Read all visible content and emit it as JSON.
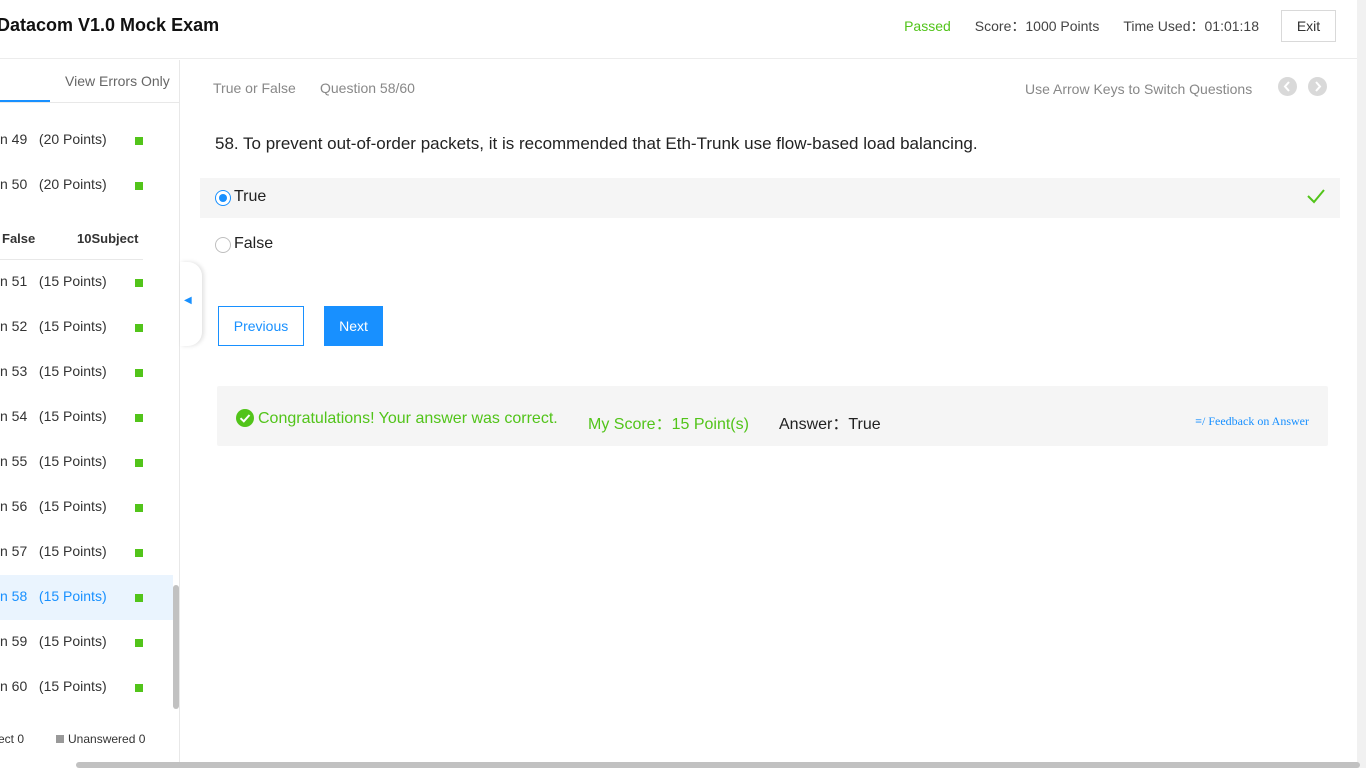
{
  "header": {
    "title": "Datacom V1.0 Mock Exam",
    "status": "Passed",
    "score": "Score：1000 Points",
    "time_used": "Time Used：01:01:18",
    "exit_label": "Exit"
  },
  "sidebar": {
    "tab_errors": "View Errors Only",
    "items_top": [
      {
        "label": "n 49   (20 Points)"
      },
      {
        "label": "n 50   (20 Points)"
      }
    ],
    "section": {
      "name": "False",
      "count": "10Subject"
    },
    "items": [
      {
        "label": "n 51   (15 Points)"
      },
      {
        "label": "n 52   (15 Points)"
      },
      {
        "label": "n 53   (15 Points)"
      },
      {
        "label": "n 54   (15 Points)"
      },
      {
        "label": "n 55   (15 Points)"
      },
      {
        "label": "n 56   (15 Points)"
      },
      {
        "label": "n 57   (15 Points)"
      },
      {
        "label": "n 58   (15 Points)"
      },
      {
        "label": "n 59   (15 Points)"
      },
      {
        "label": "n 60   (15 Points)"
      }
    ],
    "current_index": 7,
    "legend": {
      "incorrect": "ect 0",
      "unanswered": "Unanswered 0"
    },
    "collapse_glyph": "◀"
  },
  "main": {
    "question_type": "True or False",
    "question_number": "Question 58/60",
    "nav_hint": "Use Arrow Keys to Switch Questions",
    "question_text": "58. To prevent out-of-order packets, it is recommended that Eth-Trunk use flow-based load balancing.",
    "options": [
      {
        "label": "True",
        "selected": true,
        "correct": true
      },
      {
        "label": "False",
        "selected": false,
        "correct": false
      }
    ],
    "prev_label": "Previous",
    "next_label": "Next",
    "result": {
      "congrats": "Congratulations! Your answer was correct.",
      "my_score": "My Score：15 Point(s)",
      "answer": "Answer：True",
      "feedback": "≡/ Feedback on Answer"
    }
  },
  "colors": {
    "accent": "#1890ff",
    "success": "#52c41a",
    "muted": "#888888"
  }
}
